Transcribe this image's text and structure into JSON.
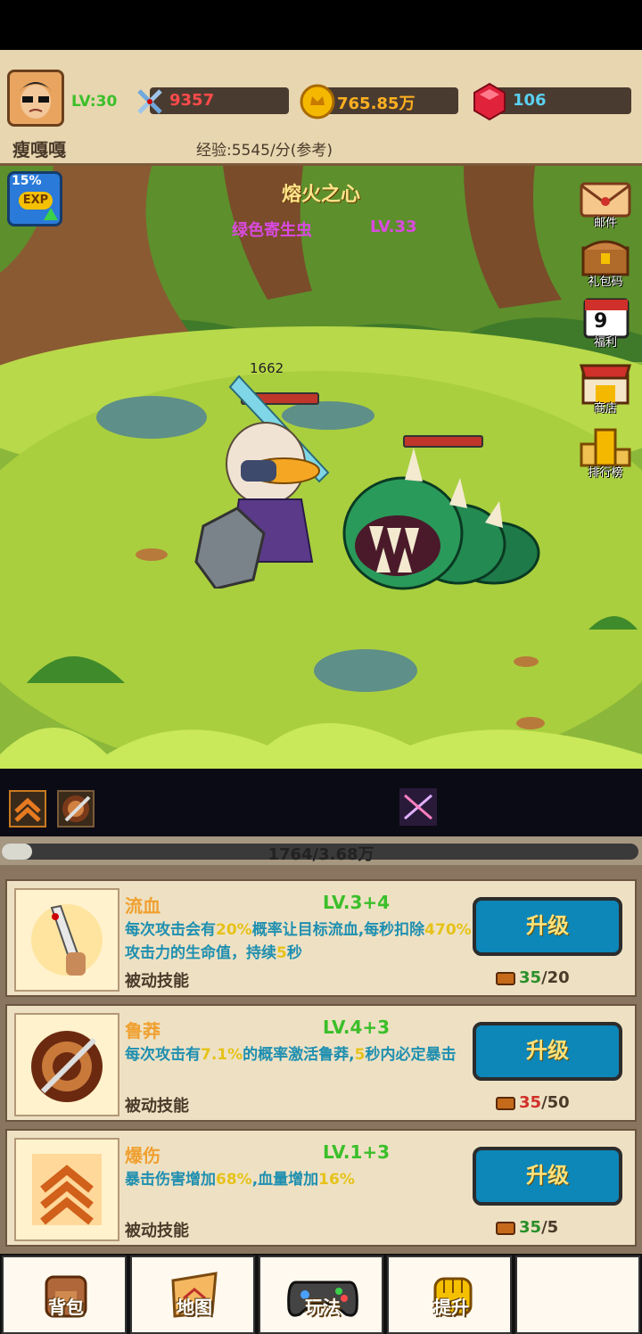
{
  "player": {
    "name": "瘦嘎嘎",
    "level": "LV:30",
    "attack": "9357",
    "gold": "765.85万",
    "gems": "106",
    "exp_rate": "经验:5545/分(参考)"
  },
  "exp_boost": {
    "percent": "15%",
    "label": "EXP"
  },
  "stage": {
    "title": "熔火之心",
    "monster_name": "绿色寄生虫",
    "monster_level": "LV.33",
    "damage_number": "1662"
  },
  "side_menu": [
    {
      "label": "邮件",
      "icon": "mail-icon"
    },
    {
      "label": "礼包码",
      "icon": "treasure-chest-icon"
    },
    {
      "label": "福利",
      "icon": "calendar-icon",
      "badge": "9"
    },
    {
      "label": "商店",
      "icon": "shop-icon"
    },
    {
      "label": "排行榜",
      "icon": "trophy-icon"
    }
  ],
  "progress": {
    "text": "1764/3.68万",
    "fraction": 0.048
  },
  "skills": [
    {
      "name": "流血",
      "level": "LV.3+4",
      "desc_parts": [
        "每次攻击会有",
        "20%",
        "概率让目标流血,每秒扣除",
        "470%",
        "攻击力的生命值，持续",
        "5",
        "秒"
      ],
      "type": "被动技能",
      "button": "升级",
      "cost_have": "35",
      "cost_need": "/20",
      "cost_have_color": "#2a8f2a"
    },
    {
      "name": "鲁莽",
      "level": "LV.4+3",
      "desc_parts": [
        "每次攻击有",
        "7.1%",
        "的概率激活鲁莽,",
        "5",
        "秒内必定暴击"
      ],
      "type": "被动技能",
      "button": "升级",
      "cost_have": "35",
      "cost_need": "/50",
      "cost_have_color": "#d0302a"
    },
    {
      "name": "爆伤",
      "level": "LV.1+3",
      "desc_parts": [
        "暴击伤害增加",
        "68%",
        ",血量增加",
        "16%"
      ],
      "type": "被动技能",
      "button": "升级",
      "cost_have": "35",
      "cost_need": "/5",
      "cost_have_color": "#2a8f2a"
    }
  ],
  "bottom_nav": [
    {
      "label": "背包",
      "icon": "backpack-icon"
    },
    {
      "label": "地图",
      "icon": "map-icon"
    },
    {
      "label": "玩法",
      "icon": "gamepad-icon"
    },
    {
      "label": "提升",
      "icon": "fist-icon"
    },
    {
      "label": "",
      "icon": ""
    }
  ]
}
